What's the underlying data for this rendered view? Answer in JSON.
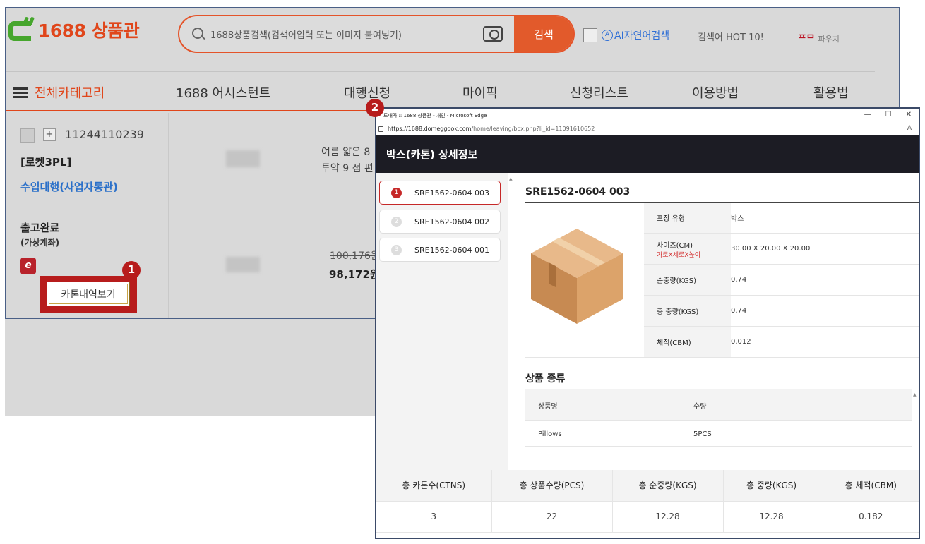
{
  "header": {
    "logo_text": "1688 상품관",
    "search_placeholder": "1688상품검색(검색어입력 또는 이미지 붙여넣기)",
    "search_button": "검색",
    "ai_search_icon": "A",
    "ai_search_label": "AI자연어검색",
    "hot_keywords": "검색어 HOT 10!",
    "mini_logo": "ᄑᄆ",
    "mini_logo_sub": "파우치"
  },
  "nav": {
    "all_categories": "전체카테고리",
    "items": [
      "1688 어시스턴트",
      "대행신청",
      "마이픽",
      "신청리스트",
      "이용방법",
      "활용법"
    ]
  },
  "order": {
    "plus": "+",
    "number": "11244110239",
    "rocket": "[로켓3PL]",
    "import_type": "수입대행(사업자통관)",
    "desc_line1": "여름 얇은 8",
    "desc_line2": "투약 9 점 편",
    "status": "출고완료",
    "payment": "(가상계좌)",
    "e_icon": "e",
    "price_old": "100,176원",
    "price_new": "98,172원",
    "carton_button": "카톤내역보기"
  },
  "badges": {
    "one": "1",
    "two": "2"
  },
  "popup": {
    "window_title": "도매꾹 :: 1688 상품관 - 개인 - Microsoft Edge",
    "window_controls": {
      "minimize": "—",
      "maximize": "☐",
      "close": "✕"
    },
    "url_host": "https://1688.domeggook.com",
    "url_path": "/home/leaving/box.php?li_id=11091610652",
    "reader_icon": "A",
    "header": "박스(카톤) 상세정보",
    "boxes": [
      {
        "num": "1",
        "label": "SRE1562-0604 003"
      },
      {
        "num": "2",
        "label": "SRE1562-0604 002"
      },
      {
        "num": "3",
        "label": "SRE1562-0604 001"
      }
    ],
    "selected_box": "SRE1562-0604 003",
    "specs": [
      {
        "key": "포장 유형",
        "sub": "",
        "value": "박스"
      },
      {
        "key": "사이즈(CM)",
        "sub": "가로X세로X높이",
        "value": "30.00 X 20.00 X 20.00"
      },
      {
        "key": "순중량(KGS)",
        "sub": "",
        "value": "0.74"
      },
      {
        "key": "총 중량(KGS)",
        "sub": "",
        "value": "0.74"
      },
      {
        "key": "체적(CBM)",
        "sub": "",
        "value": "0.012"
      }
    ],
    "product_section_title": "상품 종류",
    "product_headers": {
      "name": "상품명",
      "qty": "수량"
    },
    "products": [
      {
        "name": "Pillows",
        "qty": "5PCS"
      }
    ],
    "summary_headers": [
      "총 카톤수(CTNS)",
      "총 상품수량(PCS)",
      "총 순중량(KGS)",
      "총 중량(KGS)",
      "총 체적(CBM)"
    ],
    "summary_values": [
      "3",
      "22",
      "12.28",
      "12.28",
      "0.182"
    ]
  },
  "colors": {
    "brand_orange": "#e0461b",
    "brand_green": "#46a62d",
    "badge_red": "#b71c1c",
    "link_blue": "#2b70c9"
  }
}
